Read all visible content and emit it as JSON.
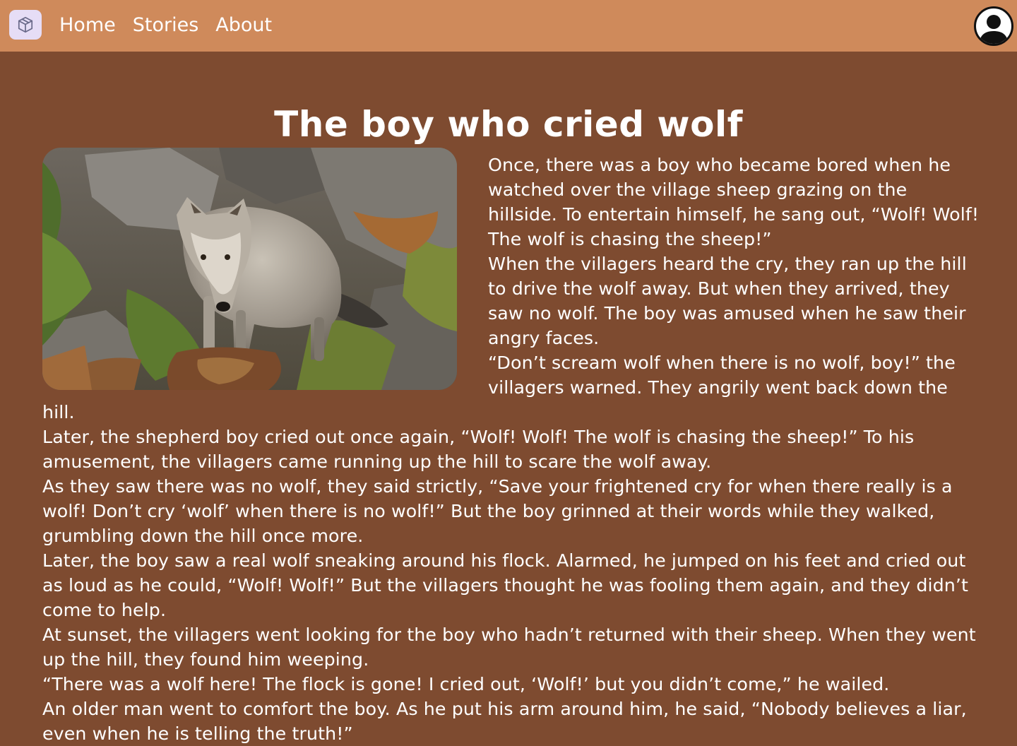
{
  "nav": {
    "logo_icon": "box-icon",
    "links": [
      "Home",
      "Stories",
      "About"
    ],
    "profile_icon": "user-icon"
  },
  "story": {
    "title": "The boy who cried wolf",
    "image_subject": "wolf",
    "paragraphs": [
      "Once, there was a boy who became bored when he watched over the village sheep grazing on the hillside. To entertain himself, he sang out, “Wolf! Wolf! The wolf is chasing the sheep!”",
      "When the villagers heard the cry, they ran up the hill to drive the wolf away. But when they arrived, they saw no wolf. The boy was amused when he saw their angry faces.",
      "“Don’t scream wolf when there is no wolf, boy!” the villagers warned. They angrily went back down the hill.",
      "Later, the shepherd boy cried out once again, “Wolf! Wolf! The wolf is chasing the sheep!” To his amusement, the villagers came running up the hill to scare the wolf away.",
      "As they saw there was no wolf, they said strictly, “Save your frightened cry for when there really is a wolf! Don’t cry ‘wolf’ when there is no wolf!” But the boy grinned at their words while they walked, grumbling down the hill once more.",
      "Later, the boy saw a real wolf sneaking around his flock. Alarmed, he jumped on his feet and cried out as loud as he could, “Wolf! Wolf!” But the villagers thought he was fooling them again, and they didn’t come to help.",
      "At sunset, the villagers went looking for the boy who hadn’t returned with their sheep. When they went up the hill, they found him weeping.",
      "“There was a wolf here! The flock is gone! I cried out, ‘Wolf!’ but you didn’t come,” he wailed.",
      "An older man went to comfort the boy. As he put his arm around him, he said, “Nobody believes a liar, even when he is telling the truth!”"
    ]
  },
  "colors": {
    "header_bg": "#cf8a5b",
    "page_bg": "#7e4b30",
    "logo_bg": "#e6ddf6",
    "text": "#ffffff"
  }
}
